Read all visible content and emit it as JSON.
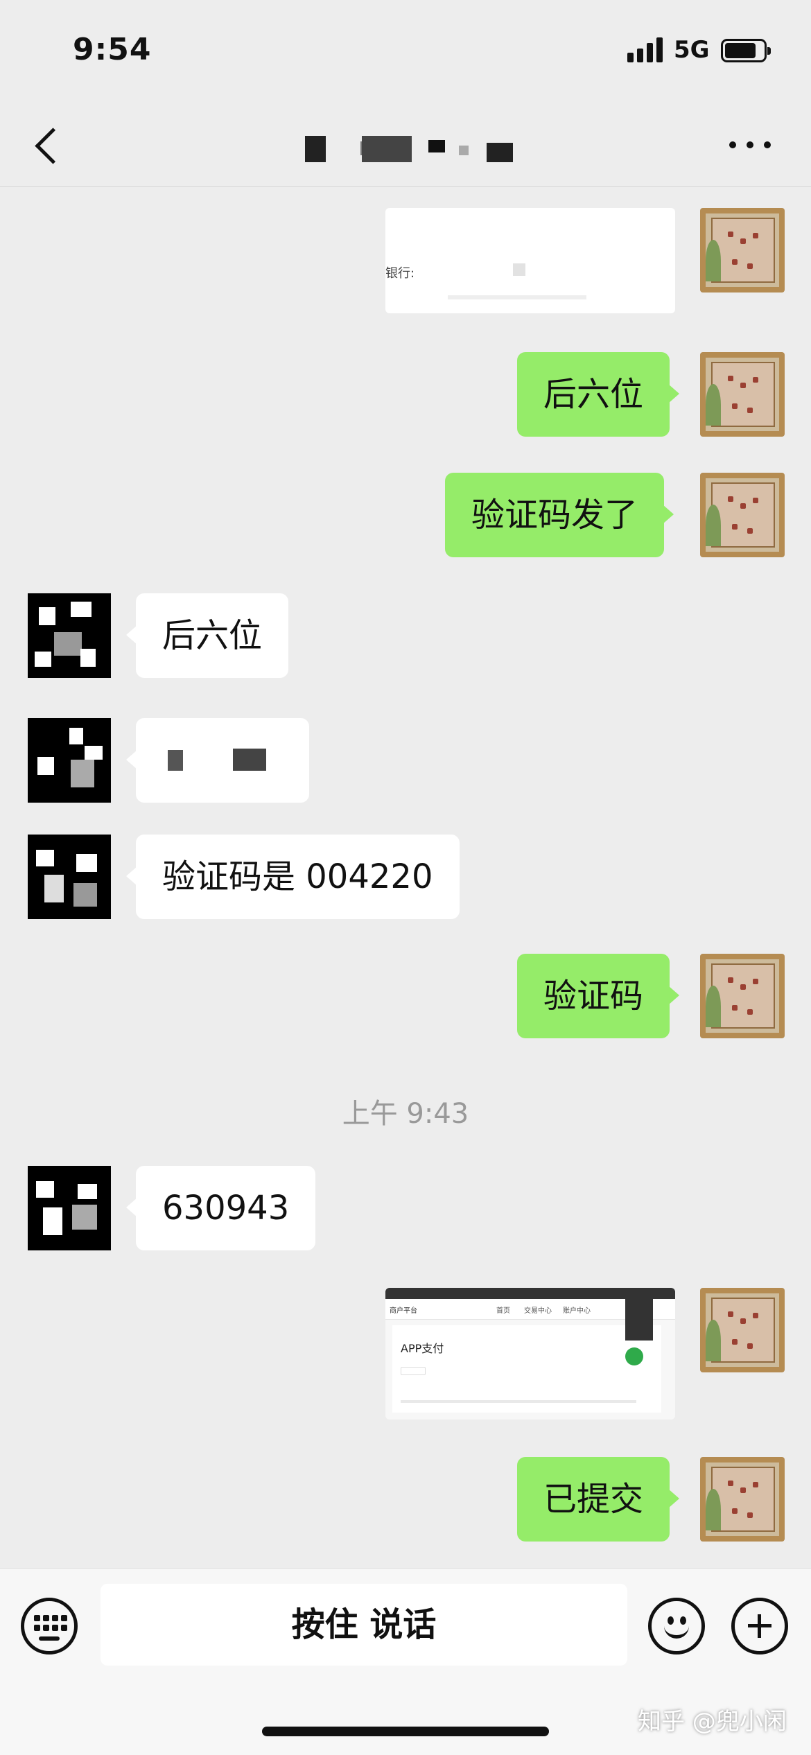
{
  "status_bar": {
    "time": "9:54",
    "network": "5G"
  },
  "messages": [
    {
      "side": "me",
      "type": "image",
      "text": "银行:"
    },
    {
      "side": "me",
      "type": "text",
      "text": "后六位"
    },
    {
      "side": "me",
      "type": "text",
      "text": "验证码发了"
    },
    {
      "side": "other",
      "type": "text",
      "text": "后六位"
    },
    {
      "side": "other",
      "type": "text",
      "text": ""
    },
    {
      "side": "other",
      "type": "text",
      "text": "验证码是 004220"
    },
    {
      "side": "me",
      "type": "text",
      "text": "验证码"
    },
    {
      "side": "system",
      "type": "timestamp",
      "text": "上午 9:43"
    },
    {
      "side": "other",
      "type": "text",
      "text": "630943"
    },
    {
      "side": "me",
      "type": "image",
      "text": "APP支付",
      "header_left": "商户平台",
      "header_tabs": [
        "首页",
        "交易中心",
        "账户中心"
      ]
    },
    {
      "side": "me",
      "type": "text",
      "text": "已提交"
    }
  ],
  "input_bar": {
    "talk_label": "按住 说话"
  },
  "watermark": "知乎 @兜小闲",
  "colors": {
    "background": "#ededed",
    "my_bubble": "#95ec69",
    "other_bubble": "#ffffff"
  },
  "icons": [
    "back-arrow-icon",
    "more-icon",
    "keyboard-icon",
    "emoji-icon",
    "plus-icon"
  ]
}
